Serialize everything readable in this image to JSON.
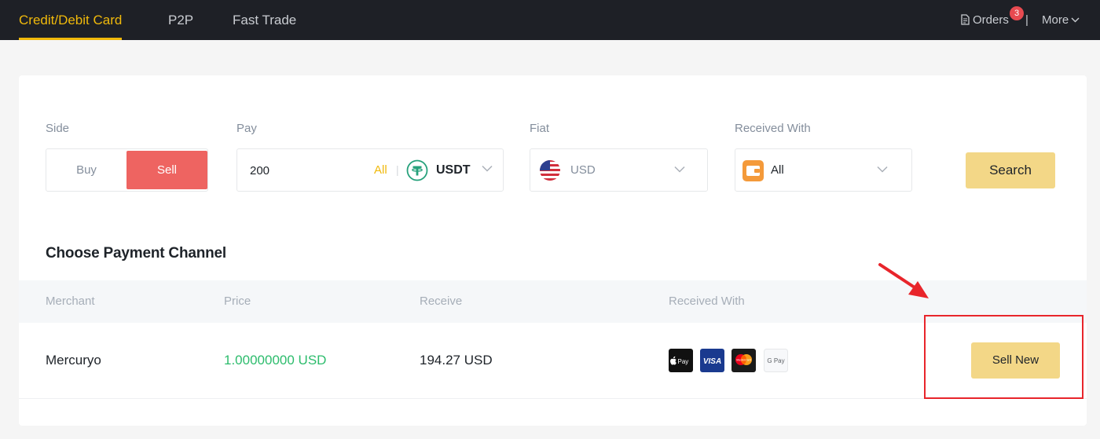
{
  "nav": {
    "tabs": [
      {
        "label": "Credit/Debit Card",
        "active": true
      },
      {
        "label": "P2P",
        "active": false
      },
      {
        "label": "Fast Trade",
        "active": false
      }
    ],
    "orders_label": "Orders",
    "orders_badge": "3",
    "separator": "|",
    "more_label": "More"
  },
  "form": {
    "side": {
      "label": "Side",
      "buy_label": "Buy",
      "sell_label": "Sell",
      "selected": "Sell"
    },
    "pay": {
      "label": "Pay",
      "amount": "200",
      "all_label": "All",
      "separator": "|",
      "currency": "USDT"
    },
    "fiat": {
      "label": "Fiat",
      "currency": "USD"
    },
    "received_with": {
      "label": "Received With",
      "value": "All"
    },
    "search_label": "Search"
  },
  "channels": {
    "title": "Choose Payment Channel",
    "columns": [
      "Merchant",
      "Price",
      "Receive",
      "Received With"
    ],
    "rows": [
      {
        "merchant": "Mercuryo",
        "price": "1.00000000 USD",
        "receive": "194.27 USD",
        "methods": [
          "Pay",
          "VISA",
          "MasterCard",
          "G Pay"
        ],
        "action": "Sell New"
      }
    ]
  },
  "colors": {
    "nav_bg": "#1e2026",
    "accent": "#f0b90b",
    "sell": "#ee6461",
    "button": "#f3d787",
    "price_green": "#2cbc6c",
    "annotation_red": "#e8252b"
  },
  "icons": {
    "orders": "document-icon",
    "more": "chevron-down-icon",
    "currency": "tether-icon",
    "fiat": "us-flag-icon",
    "received_with": "wallet-icon",
    "methods": [
      "apple-pay-icon",
      "visa-icon",
      "mastercard-icon",
      "google-pay-icon"
    ]
  }
}
